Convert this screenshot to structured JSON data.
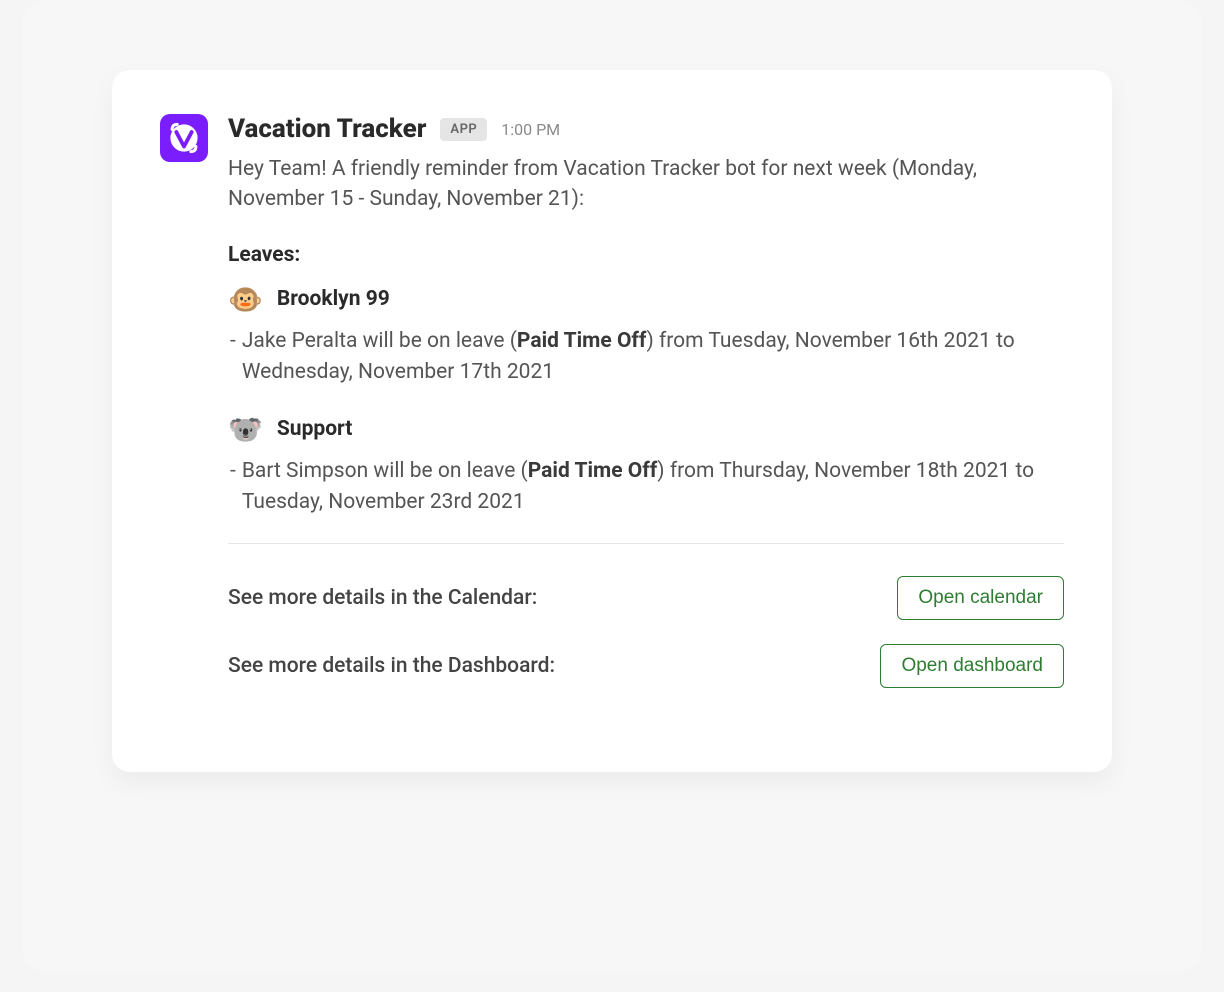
{
  "header": {
    "appName": "Vacation Tracker",
    "badge": "APP",
    "time": "1:00 PM"
  },
  "intro": "Hey Team! A friendly reminder from Vacation Tracker bot for next week (Monday, November 15 - Sunday, November 21):",
  "leavesHeading": "Leaves:",
  "groups": [
    {
      "emoji": "🐵",
      "name": "Brooklyn 99",
      "entries": [
        {
          "prefix": "Jake Peralta will be on leave (",
          "bold": "Paid Time Off",
          "suffix": ") from Tuesday, November 16th 2021 to Wednesday, November 17th 2021"
        }
      ]
    },
    {
      "emoji": "🐨",
      "name": "Support",
      "entries": [
        {
          "prefix": "Bart Simpson will be on leave (",
          "bold": "Paid Time Off",
          "suffix": ") from Thursday, November 18th 2021 to Tuesday, November 23rd 2021"
        }
      ]
    }
  ],
  "actions": {
    "calendar": {
      "label": "See more details in the Calendar:",
      "button": "Open calendar"
    },
    "dashboard": {
      "label": "See more details in the Dashboard:",
      "button": "Open dashboard"
    }
  },
  "colors": {
    "brand": "#7a1dff",
    "button": "#2e7d32"
  }
}
